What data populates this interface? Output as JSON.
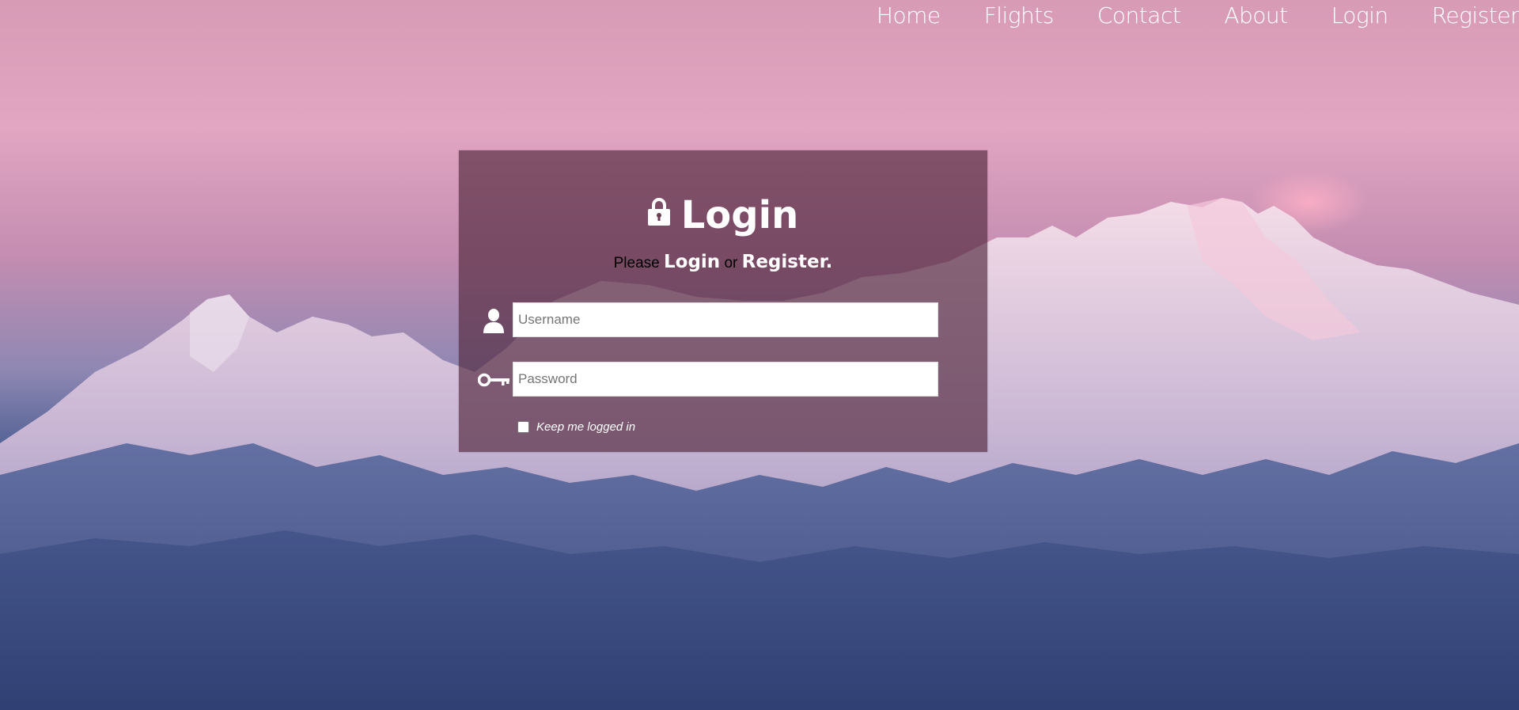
{
  "nav": {
    "items": [
      {
        "label": "Home"
      },
      {
        "label": "Flights"
      },
      {
        "label": "Contact"
      },
      {
        "label": "About"
      },
      {
        "label": "Login"
      },
      {
        "label": "Register"
      }
    ]
  },
  "login": {
    "title": "Login",
    "subtitle_please": "Please ",
    "subtitle_login": "Login",
    "subtitle_or": " or ",
    "subtitle_register": "Register.",
    "username_placeholder": "Username",
    "username_value": "",
    "password_placeholder": "Password",
    "password_value": "",
    "remember_label": "Keep me logged in",
    "remember_checked": false
  },
  "icons": {
    "title": "lock-icon",
    "username": "user-icon",
    "password": "key-icon"
  },
  "colors": {
    "card_background": "#52283c",
    "text_light": "#ffffff",
    "sky_pink": "#e2a6c2",
    "mountain_blue": "#3d4f84"
  }
}
